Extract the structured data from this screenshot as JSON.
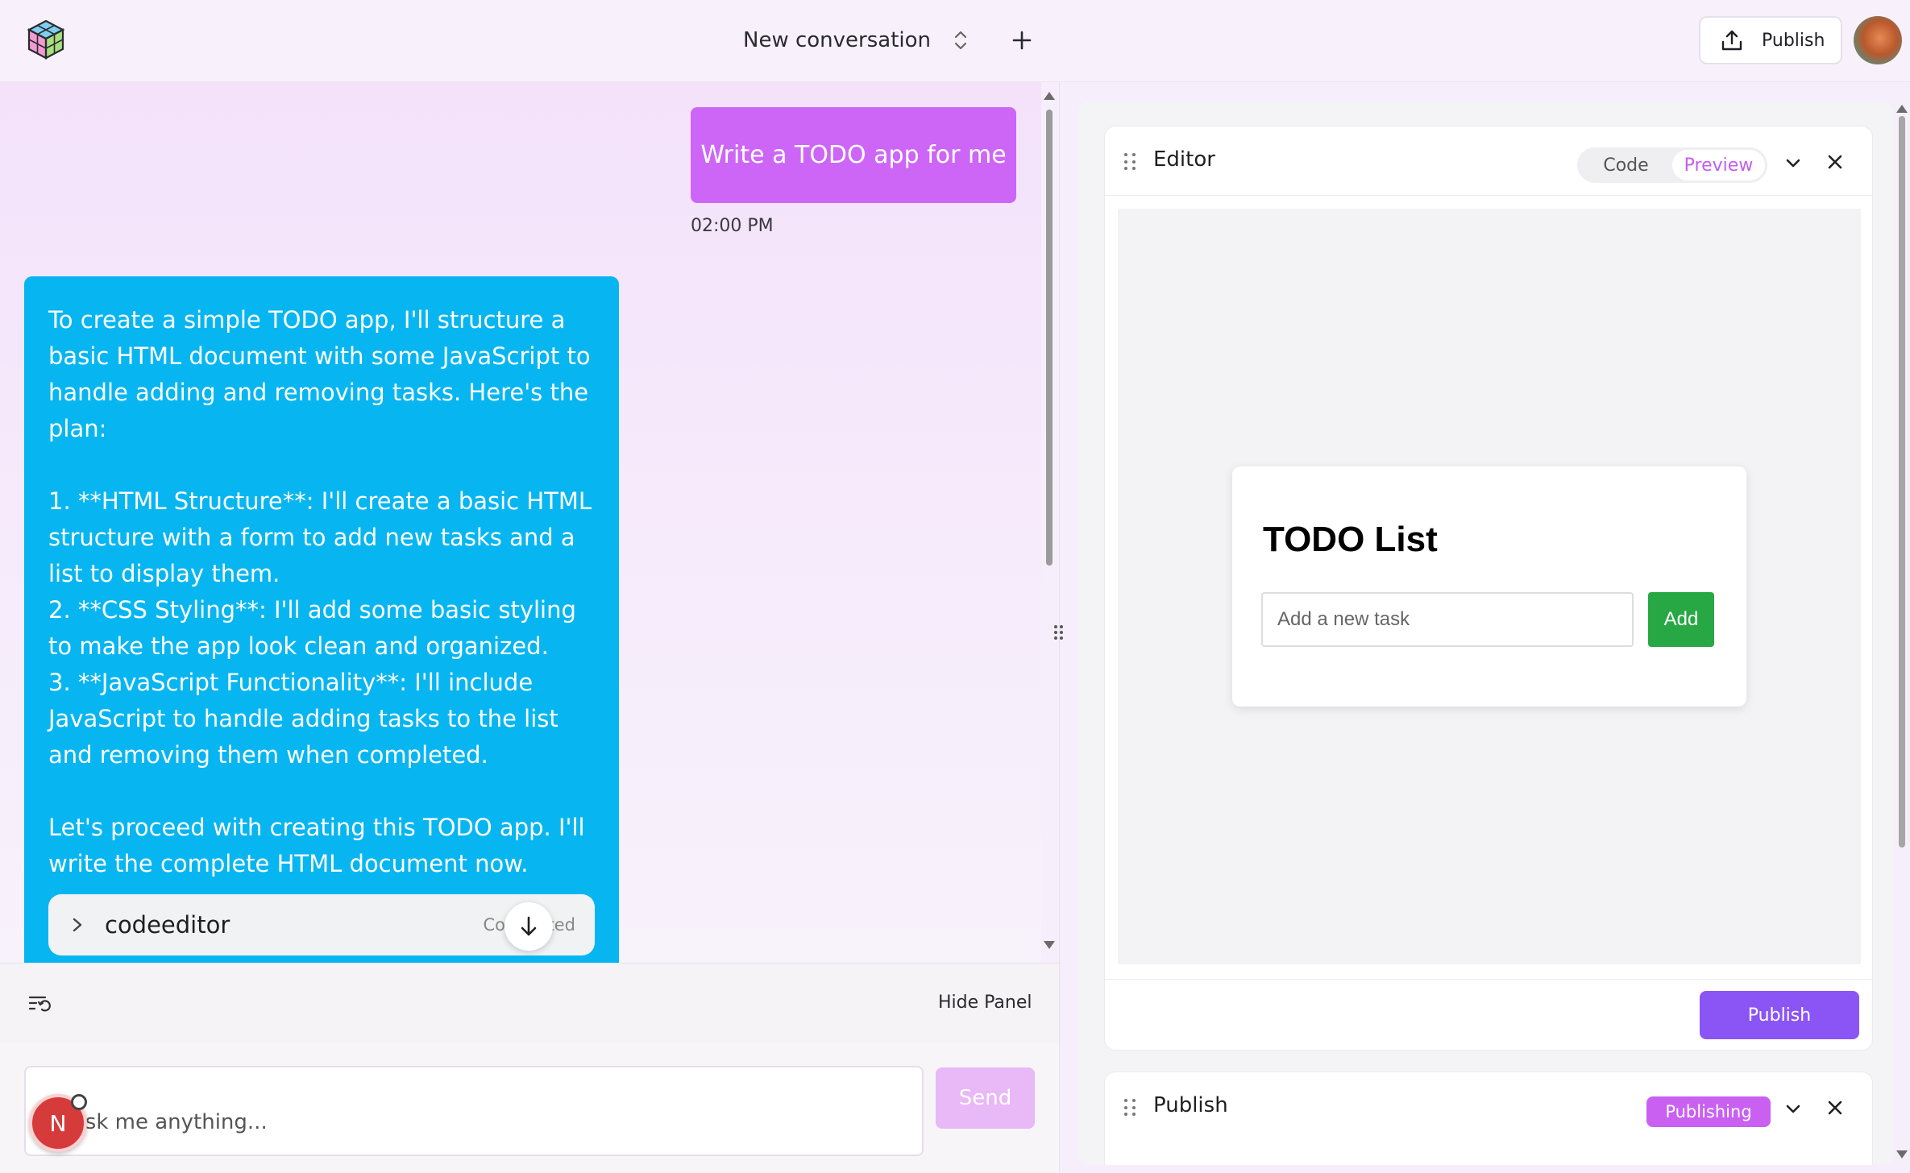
{
  "header": {
    "conversation_title": "New conversation",
    "publish_label": "Publish"
  },
  "chat": {
    "user_message": "Write a TODO app for me",
    "user_time": "02:00 PM",
    "ai_message": "To create a simple TODO app, I'll structure a basic HTML document with some JavaScript to handle adding and removing tasks. Here's the plan:\n\n1. **HTML Structure**: I'll create a basic HTML structure with a form to add new tasks and a list to display them.\n2. **CSS Styling**: I'll add some basic styling to make the app look clean and organized.\n3. **JavaScript Functionality**: I'll include JavaScript to handle adding tasks to the list and removing them when completed.\n\nLet's proceed with creating this TODO app. I'll write the complete HTML document now.",
    "code_block": {
      "name": "codeeditor",
      "status": "Completed"
    }
  },
  "bottom_bar": {
    "hide_panel_label": "Hide Panel"
  },
  "composer": {
    "placeholder": "Ask me anything...",
    "send_label": "Send"
  },
  "badge": {
    "letter": "N"
  },
  "editor_panel": {
    "title": "Editor",
    "toggle": {
      "code_label": "Code",
      "preview_label": "Preview",
      "selected": "Preview"
    },
    "preview": {
      "todo_title": "TODO List",
      "input_placeholder": "Add a new task",
      "add_label": "Add"
    },
    "publish_label": "Publish"
  },
  "publish_panel": {
    "title": "Publish",
    "status_badge": "Publishing"
  },
  "colors": {
    "user_bubble": "#cd66f7",
    "ai_bubble": "#07b6f1",
    "accent_purple": "#8b55f5",
    "preview_toggle": "#c35ef0",
    "add_button": "#28a745",
    "publishing_badge": "#c960f2"
  },
  "icons": {
    "logo": "cube-logo-icon",
    "conversation_switch": "chevron-up-down-icon",
    "new_conversation": "plus-icon",
    "publish": "upload-icon",
    "history": "history-list-icon",
    "scroll_down": "arrow-down-icon",
    "expand": "chevron-right-icon",
    "collapse": "chevron-down-icon",
    "close": "close-icon",
    "drag": "drag-handle-icon"
  }
}
